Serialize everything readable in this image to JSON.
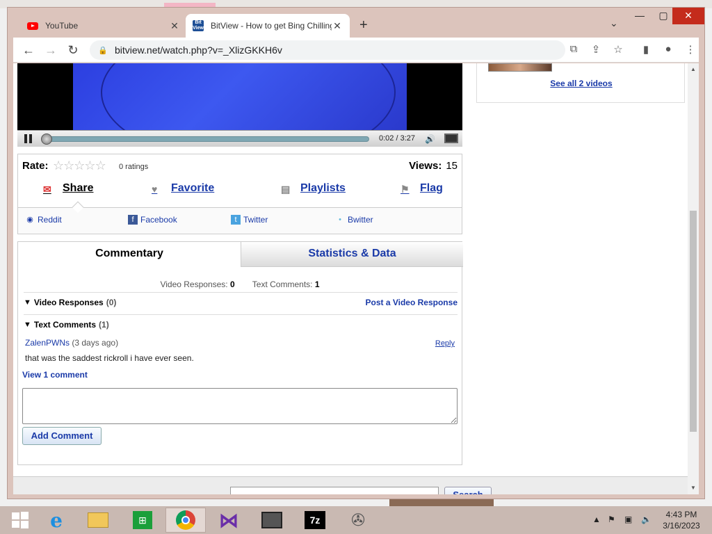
{
  "browser": {
    "tabs": [
      {
        "title": "YouTube",
        "icon": "youtube-favicon"
      },
      {
        "title": "BitView - How to get Bing Chilling",
        "icon": "bitview-favicon"
      }
    ],
    "url": "bitview.net/watch.php?v=_XlizGKKH6v"
  },
  "player": {
    "time": "0:02 / 3:27",
    "progress": 0.01
  },
  "rating": {
    "label": "Rate:",
    "stars_filled": 0,
    "stars_total": 5,
    "ratings_text": "0 ratings",
    "views_label": "Views:",
    "views_value": "15"
  },
  "actions": {
    "share": "Share",
    "favorite": "Favorite",
    "playlists": "Playlists",
    "flag": "Flag"
  },
  "share_links": {
    "reddit": "Reddit",
    "facebook": "Facebook",
    "twitter": "Twitter",
    "bwitter": "Bwitter"
  },
  "comments_box": {
    "tab_commentary": "Commentary",
    "tab_stats": "Statistics & Data",
    "video_responses_label": "Video Responses:",
    "video_responses_count": "0",
    "text_comments_label": "Text Comments:",
    "text_comments_count": "1",
    "section_video_responses": "Video Responses",
    "section_video_responses_count": "(0)",
    "post_video_response": "Post a Video Response",
    "section_text_comments": "Text Comments",
    "section_text_comments_count": "(1)",
    "comment": {
      "user": "ZalenPWNs",
      "age": "(3 days ago)",
      "text": "that was the saddest rickroll i have ever seen.",
      "reply": "Reply"
    },
    "view_comment": "View 1 comment",
    "add_comment": "Add Comment"
  },
  "sidebar": {
    "see_all": "See all 2 videos"
  },
  "footer": {
    "search_button": "Search"
  },
  "taskbar": {
    "time": "4:43 PM",
    "date": "3/16/2023"
  }
}
